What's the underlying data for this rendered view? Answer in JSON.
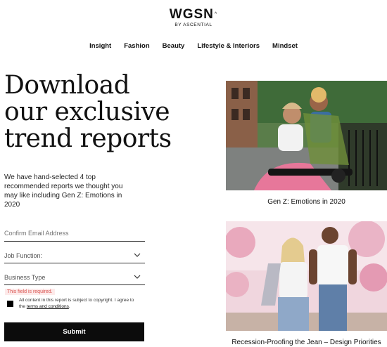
{
  "logo": {
    "brand": "WGSN",
    "mark": "^",
    "sub": "BY ASCENTIAL"
  },
  "nav": [
    "Insight",
    "Fashion",
    "Beauty",
    "Lifestyle & Interiors",
    "Mindset"
  ],
  "hero": {
    "title_lines": [
      "Download",
      "our exclusive",
      "trend reports"
    ],
    "description": "We have hand-selected 4 top recommended reports we thought you may like including Gen Z: Emotions in 2020"
  },
  "form": {
    "email_placeholder": "Confirm Email Address",
    "job_function_label": "Job Function:",
    "business_type_label": "Business Type",
    "error_text": "This field is required.",
    "consent_text": "All content in this report is subject to copyright. I agree to the",
    "terms_link": "terms and conditions",
    "consent_end": ".",
    "submit_label": "Submit"
  },
  "reports": [
    {
      "caption": "Gen Z: Emotions in 2020"
    },
    {
      "caption": "Recession-Proofing the Jean – Design Priorities"
    }
  ],
  "colors": {
    "error": "#d9534f",
    "button": "#0c0c0c"
  }
}
